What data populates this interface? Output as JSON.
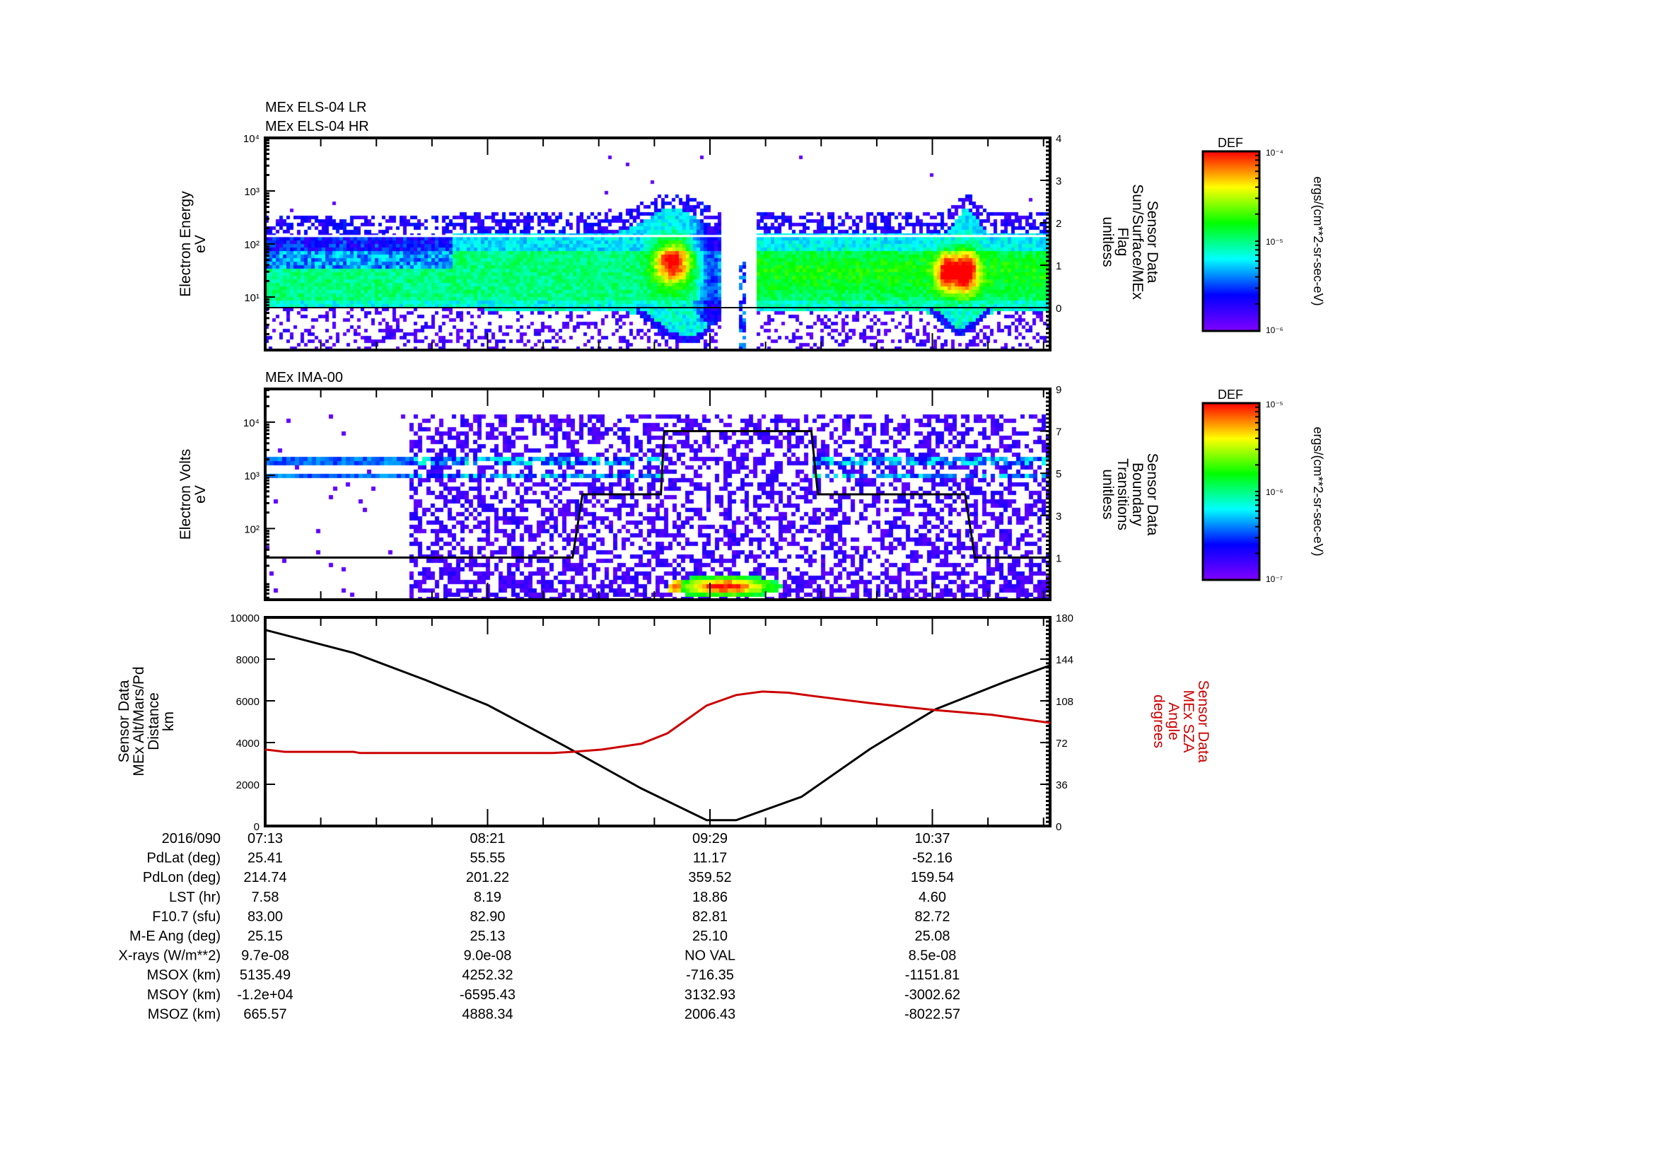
{
  "chart_data": [
    {
      "type": "heatmap",
      "titles": [
        "MEx ELS-04 LR",
        "MEx ELS-04 HR"
      ],
      "ylabel": [
        "Electron Energy",
        "eV"
      ],
      "yscale": "log",
      "ylim": [
        1,
        10000
      ],
      "yticks": [
        "10¹",
        "10²",
        "10³",
        "10⁴"
      ],
      "y2label": [
        "Sensor Data",
        "Sun/Surface/MEx",
        "Flag",
        "unitless"
      ],
      "y2lim": [
        -1,
        4
      ],
      "y2ticks": [
        "0",
        "1",
        "2",
        "3",
        "4"
      ],
      "flag_line": {
        "color": "#000000",
        "x": [
          "07:13",
          "11:13"
        ],
        "y": [
          0,
          0
        ]
      },
      "colorbar": {
        "title": "DEF",
        "scale": "log",
        "range": [
          "10⁻⁶",
          "10⁻⁴"
        ],
        "ticks": [
          "10⁻⁴",
          "10⁻⁵",
          "10⁻⁶"
        ],
        "unit": "ergs/(cm**2-sr-sec-eV)",
        "colormap": [
          "#7f00ff",
          "#0000ff",
          "#00ffff",
          "#00ff00",
          "#ffff00",
          "#ff0000"
        ]
      }
    },
    {
      "type": "heatmap",
      "titles": [
        "MEx IMA-00"
      ],
      "ylabel": [
        "Electron Volts",
        "eV"
      ],
      "yscale": "log",
      "ylim": [
        4.6,
        42000
      ],
      "yticks": [
        "10²",
        "10³",
        "10⁴"
      ],
      "y2label": [
        "Sensor Data",
        "Boundary",
        "Transitions",
        "unitless"
      ],
      "y2lim": [
        -1,
        9
      ],
      "y2ticks": [
        "1",
        "3",
        "5",
        "7",
        "9"
      ],
      "boundary_line": {
        "color": "#000000",
        "x": [
          "07:13",
          "08:47",
          "08:50",
          "09:14",
          "09:15",
          "10:00",
          "10:02",
          "10:47",
          "10:50",
          "11:13"
        ],
        "y": [
          1,
          1,
          4,
          4,
          7,
          7,
          4,
          4,
          1,
          1
        ]
      },
      "colorbar": {
        "title": "DEF",
        "scale": "log",
        "range": [
          "10⁻⁷",
          "10⁻⁵"
        ],
        "ticks": [
          "10⁻⁵",
          "10⁻⁶",
          "10⁻⁷"
        ],
        "unit": "ergs/(cm**2-sr-sec-eV)",
        "colormap": [
          "#7f00ff",
          "#0000ff",
          "#00ffff",
          "#00ff00",
          "#ffff00",
          "#ff0000"
        ]
      }
    },
    {
      "type": "line",
      "xlim": [
        "07:13",
        "11:13"
      ],
      "ylabel": [
        "Sensor Data",
        "MEx Alt/Mars/Pd",
        "Distance",
        "km"
      ],
      "ylim": [
        0,
        10000
      ],
      "yticks": [
        "0",
        "2000",
        "4000",
        "6000",
        "8000",
        "10000"
      ],
      "y2label": [
        "Sensor Data",
        "MEx SZA",
        "Angle",
        "degrees"
      ],
      "y2lim": [
        0,
        180
      ],
      "y2ticks": [
        "0",
        "36",
        "72",
        "108",
        "144",
        "180"
      ],
      "y2color": "#cc0000",
      "series": [
        {
          "axis": "left",
          "color": "#000000",
          "x": [
            "07:13",
            "07:40",
            "08:02",
            "08:21",
            "08:45",
            "09:08",
            "09:28",
            "09:37",
            "09:57",
            "10:18",
            "10:38",
            "10:59",
            "11:13"
          ],
          "y": [
            9400,
            8300,
            7000,
            5800,
            3800,
            1800,
            280,
            280,
            1400,
            3700,
            5600,
            6900,
            7700
          ]
        },
        {
          "axis": "right",
          "color": "#cc0000",
          "x": [
            "07:13",
            "07:19",
            "07:40",
            "07:42",
            "08:41",
            "08:47",
            "08:56",
            "09:08",
            "09:16",
            "09:22",
            "09:28",
            "09:37",
            "09:45",
            "09:53",
            "10:01",
            "10:18",
            "10:38",
            "10:55",
            "11:13"
          ],
          "y": [
            66,
            64,
            64,
            63,
            63,
            64,
            66,
            71,
            80,
            92,
            104,
            113,
            116,
            115,
            112,
            106,
            100,
            96,
            89
          ]
        }
      ]
    }
  ],
  "time_axis": {
    "date": "2016/090",
    "ticks": [
      "07:13",
      "08:21",
      "09:29",
      "10:37"
    ]
  },
  "ephemeris": {
    "rows": [
      {
        "label": "PdLat (deg)",
        "values": [
          "25.41",
          "55.55",
          "11.17",
          "-52.16"
        ]
      },
      {
        "label": "PdLon (deg)",
        "values": [
          "214.74",
          "201.22",
          "359.52",
          "159.54"
        ]
      },
      {
        "label": "LST (hr)",
        "values": [
          "7.58",
          "8.19",
          "18.86",
          "4.60"
        ]
      },
      {
        "label": "F10.7 (sfu)",
        "values": [
          "83.00",
          "82.90",
          "82.81",
          "82.72"
        ]
      },
      {
        "label": "M-E Ang (deg)",
        "values": [
          "25.15",
          "25.13",
          "25.10",
          "25.08"
        ]
      },
      {
        "label": "X-rays (W/m**2)",
        "values": [
          "9.7e-08",
          "9.0e-08",
          "NO VAL",
          "8.5e-08"
        ]
      },
      {
        "label": "MSOX (km)",
        "values": [
          "5135.49",
          "4252.32",
          "-716.35",
          "-1151.81"
        ]
      },
      {
        "label": "MSOY (km)",
        "values": [
          "-1.2e+04",
          "-6595.43",
          "3132.93",
          "-3002.62"
        ]
      },
      {
        "label": "MSOZ (km)",
        "values": [
          "665.57",
          "4888.34",
          "2006.43",
          "-8022.57"
        ]
      }
    ]
  }
}
